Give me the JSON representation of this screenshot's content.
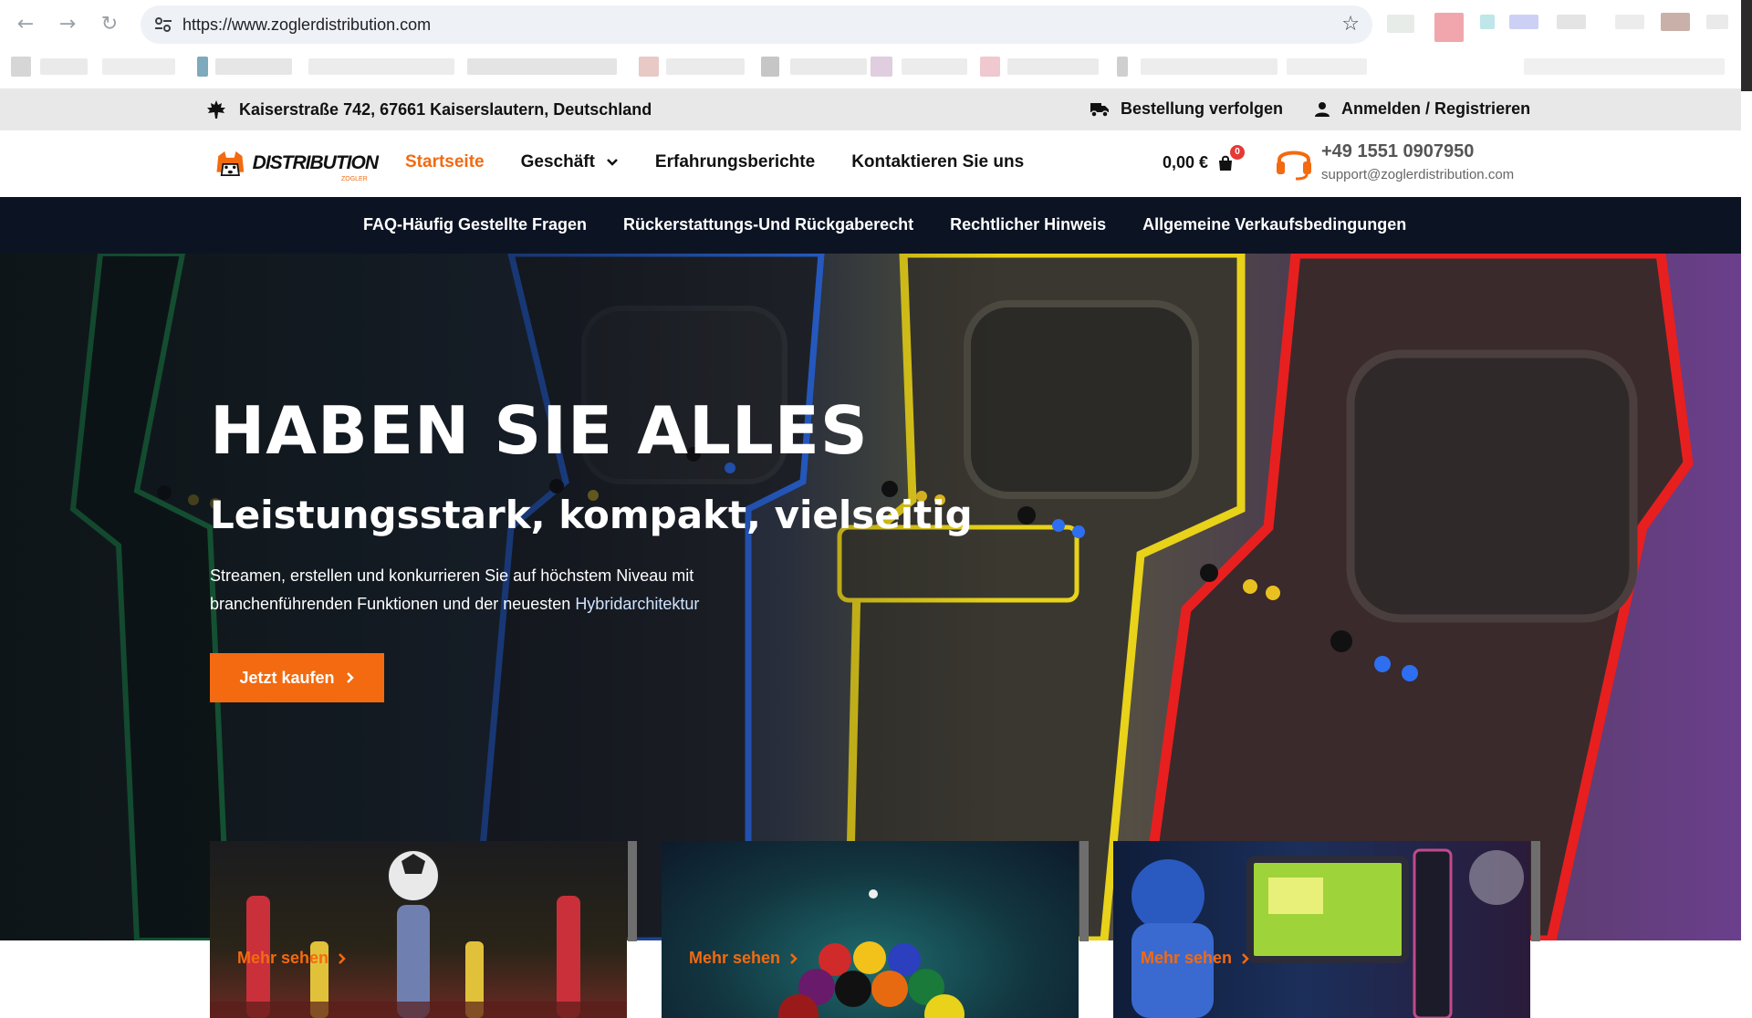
{
  "browser": {
    "url": "https://www.zoglerdistribution.com"
  },
  "topbar": {
    "address": "Kaiserstraße 742, 67661 Kaiserslautern, Deutschland",
    "track_order": "Bestellung verfolgen",
    "login": "Anmelden / Registrieren"
  },
  "header": {
    "logo_text": "DISTRIBUTION",
    "logo_sub": "ZOGLER",
    "nav": {
      "home": "Startseite",
      "shop": "Geschäft",
      "reviews": "Erfahrungsberichte",
      "contact": "Kontaktieren Sie uns"
    },
    "cart_total": "0,00 €",
    "cart_count": "0",
    "phone": "+49 1551 0907950",
    "email": "support@zoglerdistribution.com"
  },
  "subnav": {
    "faq": "FAQ-Häufig Gestellte Fragen",
    "refund": "Rückerstattungs-Und Rückgaberecht",
    "legal": "Rechtlicher Hinweis",
    "terms": "Allgemeine Verkaufsbedingungen"
  },
  "hero": {
    "title": "HABEN SIE ALLES",
    "subtitle": "Leistungsstark, kompakt, vielseitig",
    "desc_part1": "Streamen, erstellen und konkurrieren Sie auf höchstem Niveau mit branchenführenden Funktionen und der neuesten ",
    "desc_link": "Hybridarchitektur",
    "cta": "Jetzt kaufen"
  },
  "cards": [
    {
      "label": "Mehr sehen"
    },
    {
      "label": "Mehr sehen"
    },
    {
      "label": "Mehr sehen"
    }
  ],
  "colors": {
    "accent": "#f36a10",
    "dark_nav": "#0c1424",
    "topbar": "#e8e8e8"
  }
}
